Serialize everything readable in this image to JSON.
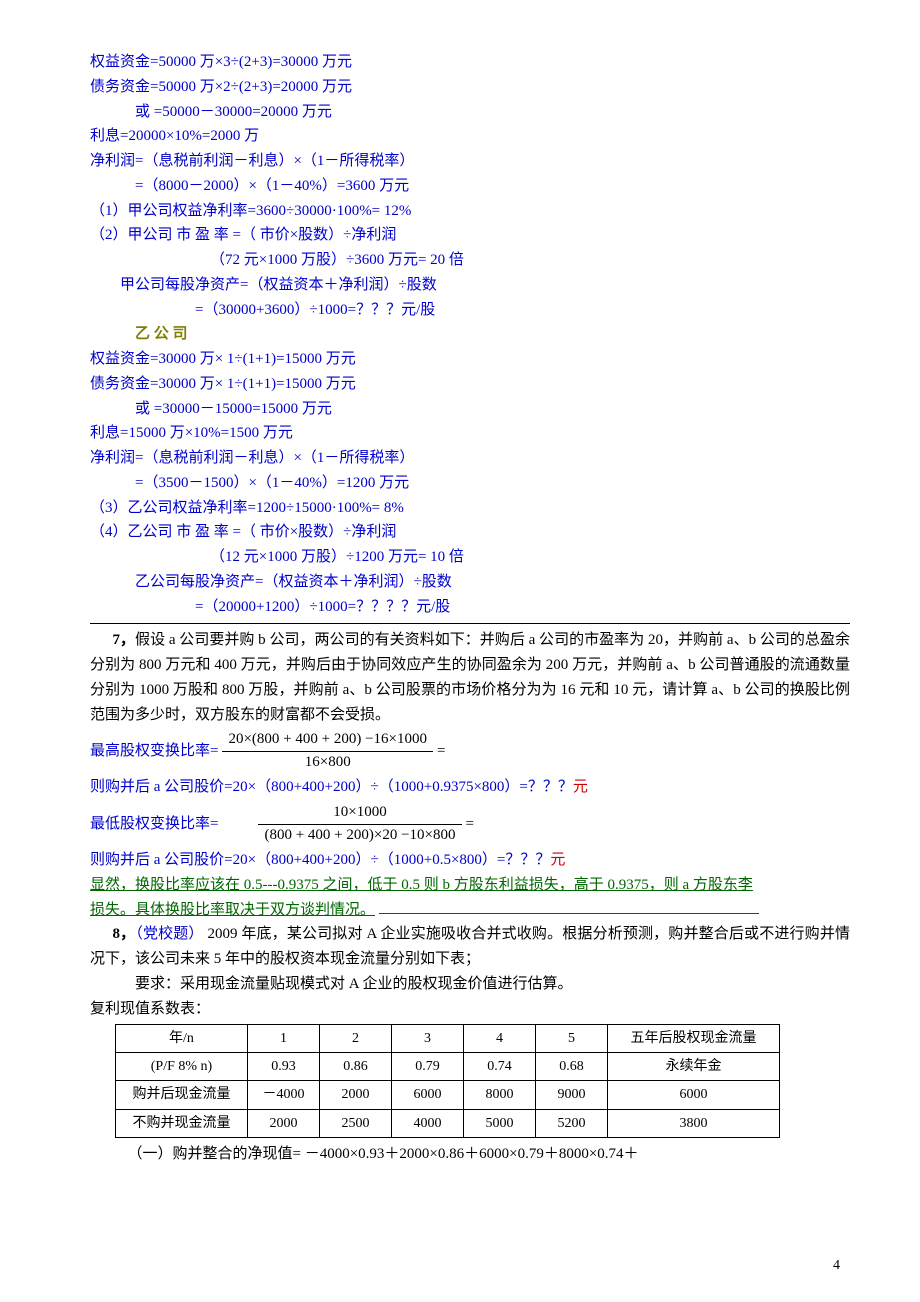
{
  "jia": {
    "l1": "权益资金=50000 万×3÷(2+3)=30000 万元",
    "l2": "债务资金=50000 万×2÷(2+3)=20000 万元",
    "l3": "或   =50000－30000=20000 万元",
    "l4": "利息=20000×10%=2000 万",
    "l5": "净利润=（息税前利润－利息）×（1－所得税率）",
    "l6": "=（8000－2000）×（1－40%）=3600 万元",
    "l7": "（1）甲公司权益净利率=3600÷30000·100%= 12%",
    "l8": "（2）甲公司  市  盈  率  =（ 市价×股数）÷净利润",
    "l9": "（72 元×1000 万股）÷3600 万元= 20 倍",
    "l10": "甲公司每股净资产=（权益资本＋净利润）÷股数",
    "l11": "=（30000+3600）÷1000=？？？元/股"
  },
  "yi_title": "乙  公  司",
  "yi": {
    "l1": "权益资金=30000 万× 1÷(1+1)=15000 万元",
    "l2": "债务资金=30000 万× 1÷(1+1)=15000 万元",
    "l3": "或   =30000－15000=15000 万元",
    "l4": "利息=15000 万×10%=1500 万元",
    "l5": "净利润=（息税前利润－利息）×（1－所得税率）",
    "l6": "=（3500－1500）×（1－40%）=1200 万元",
    "l7": "（3）乙公司权益净利率=1200÷15000·100%= 8%",
    "l8": "（4）乙公司  市  盈  率  =（ 市价×股数）÷净利润",
    "l9": "（12 元×1000 万股）÷1200 万元= 10 倍",
    "l10": "乙公司每股净资产=（权益资本＋净利润）÷股数",
    "l11": "=（20000+1200）÷1000=？？？？元/股"
  },
  "q7": {
    "title": "7，",
    "body1": "假设 a 公司要并购 b 公司，两公司的有关资料如下：并购后 a 公司的市盈率为 20，并购前 a、b 公司的总盈余分别为 800 万元和 400 万元，并购后由于协同效应产生的协同盈余为 200 万元，并购前 a、b 公司普通股的流通数量分别为 1000 万股和 800 万股，并购前 a、b 公司股票的市场价格分为为 16 元和 10 元，请计算 a、b 公司的换股比例范围为多少时，双方股东的财富都不会受损。",
    "max_label": "最高股权变换比率=",
    "max_num": "20×(800 + 400 + 200) −16×1000",
    "max_den": "16×800",
    "eq_suffix": "=",
    "max_after": "则购并后 a 公司股价=20×（800+400+200）÷（1000+0.9375×800）=？？？",
    "max_after_yuan": "元",
    "min_label": "最低股权变换比率=",
    "min_num": "10×1000",
    "min_den": "(800 + 400 + 200)×20 −10×800",
    "min_after": "则购并后 a 公司股价=20×（800+400+200）÷（1000+0.5×800）=？？？",
    "min_after_yuan": "元",
    "sum1": "显然，换股比率应该在 0.5---0.9375 之间，低于 0.5 则 b 方股东利益损失，高于 0.9375，则 a 方股东李",
    "sum2": "损失。具体换股比率取决于双方谈判情况。"
  },
  "q8": {
    "prefix": "8，",
    "party": "（党校题）",
    "body": " 2009 年底，某公司拟对 A 企业实施吸收合并式收购。根据分析预测，购并整合后或不进行购并情况下，该公司未来 5 年中的股权资本现金流量分别如下表；",
    "req": "要求：采用现金流量贴现模式对 A 企业的股权现金价值进行估算。",
    "tbl_title": "复利现值系数表：",
    "headers": [
      "年/n",
      "1",
      "2",
      "3",
      "4",
      "5",
      "五年后股权现金流量"
    ],
    "r1": [
      "(P/F 8% n)",
      "0.93",
      "0.86",
      "0.79",
      "0.74",
      "0.68",
      "永续年金"
    ],
    "r2": [
      "购并后现金流量",
      "－4000",
      "2000",
      "6000",
      "8000",
      "9000",
      "6000"
    ],
    "r3": [
      "不购并现金流量",
      "2000",
      "2500",
      "4000",
      "5000",
      "5200",
      "3800"
    ],
    "calc": "（一）购并整合的净现值=   －4000×0.93＋2000×0.86＋6000×0.79＋8000×0.74＋"
  },
  "pagenum": "4"
}
